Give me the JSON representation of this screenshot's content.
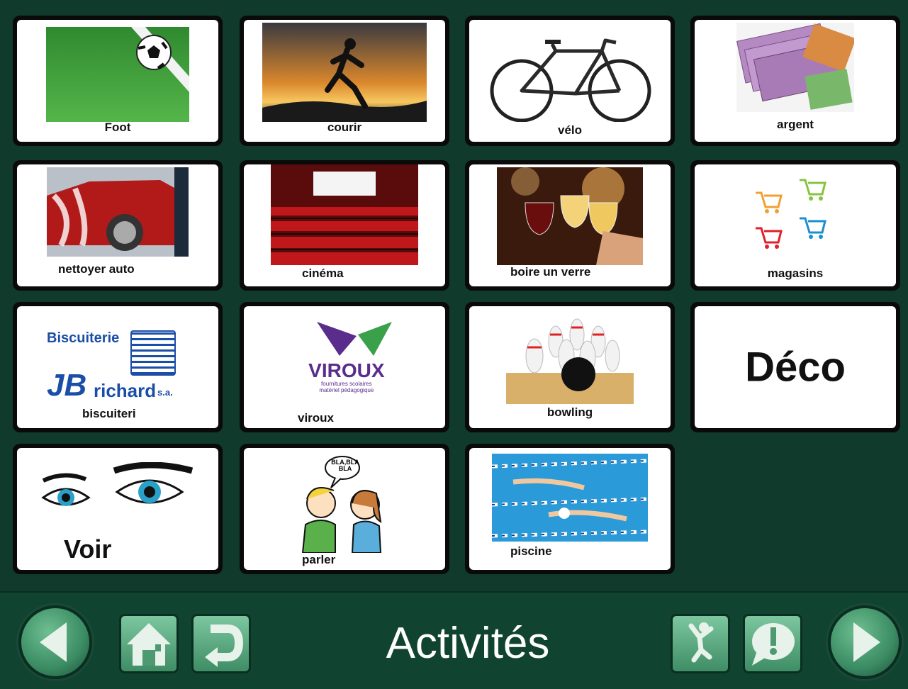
{
  "grid": {
    "cells": [
      {
        "label": "Foot",
        "icon": "soccer-ball-icon"
      },
      {
        "label": "courir",
        "icon": "runner-icon"
      },
      {
        "label": "vélo",
        "icon": "bicycle-icon"
      },
      {
        "label": "argent",
        "icon": "money-icon"
      },
      {
        "label": "nettoyer auto",
        "icon": "car-wash-icon"
      },
      {
        "label": "cinéma",
        "icon": "cinema-icon"
      },
      {
        "label": "boire un verre",
        "icon": "wine-glasses-icon"
      },
      {
        "label": "magasins",
        "icon": "shopping-carts-icon"
      },
      {
        "label": "biscuiteri",
        "icon": "biscuiterie-logo"
      },
      {
        "label": "viroux",
        "icon": "viroux-logo"
      },
      {
        "label": "bowling",
        "icon": "bowling-icon"
      },
      {
        "label": "Déco",
        "icon": ""
      },
      {
        "label": "Voir",
        "icon": "eyes-icon"
      },
      {
        "label": "parler",
        "icon": "speaking-people-icon"
      },
      {
        "label": "piscine",
        "icon": "swimming-pool-icon"
      }
    ],
    "logos": {
      "biscuiterie_top": "Biscuiterie",
      "biscuiterie_bottom": "richard",
      "biscuiterie_sa": "s.a.",
      "viroux_name": "VIROUX",
      "viroux_line1": "fournitures scolaires",
      "viroux_line2": "matériel pédagogique",
      "speech_bubble": "BLA,BLA BLA"
    }
  },
  "toolbar": {
    "title": "Activités",
    "back_icon": "left-arrow-icon",
    "home_icon": "home-icon",
    "undo_icon": "return-icon",
    "activity_icon": "jumping-person-icon",
    "alert_icon": "exclamation-bubble-icon",
    "forward_icon": "right-arrow-icon"
  },
  "colors": {
    "background": "#0f3a2c",
    "button_green": "#5aa87d"
  }
}
